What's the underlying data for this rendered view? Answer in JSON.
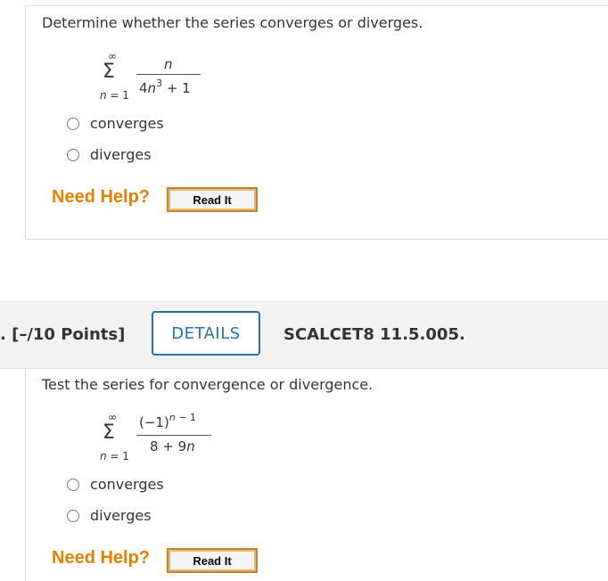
{
  "q1": {
    "prompt": "Determine whether the series converges or diverges.",
    "series": {
      "sigma": "Σ",
      "upper": "∞",
      "lower_var": "n",
      "lower_rest": " = 1",
      "numerator": "n",
      "den_coef": "4",
      "den_var": "n",
      "den_exp": "3",
      "den_rest": " + 1"
    },
    "options": [
      "converges",
      "diverges"
    ],
    "need_help": "Need Help?",
    "read_it": "Read It"
  },
  "q2_header": {
    "points": ". [–/10 Points]",
    "details": "DETAILS",
    "source": "SCALCET8 11.5.005."
  },
  "q2": {
    "prompt": "Test the series for convergence or divergence.",
    "series": {
      "sigma": "Σ",
      "upper": "∞",
      "lower_var": "n",
      "lower_rest": " = 1",
      "num_base": "(−1)",
      "num_exp_var": "n",
      "num_exp_rest": " − 1",
      "den_const": "8 + 9",
      "den_var": "n"
    },
    "options": [
      "converges",
      "diverges"
    ],
    "need_help": "Need Help?",
    "read_it": "Read It"
  }
}
